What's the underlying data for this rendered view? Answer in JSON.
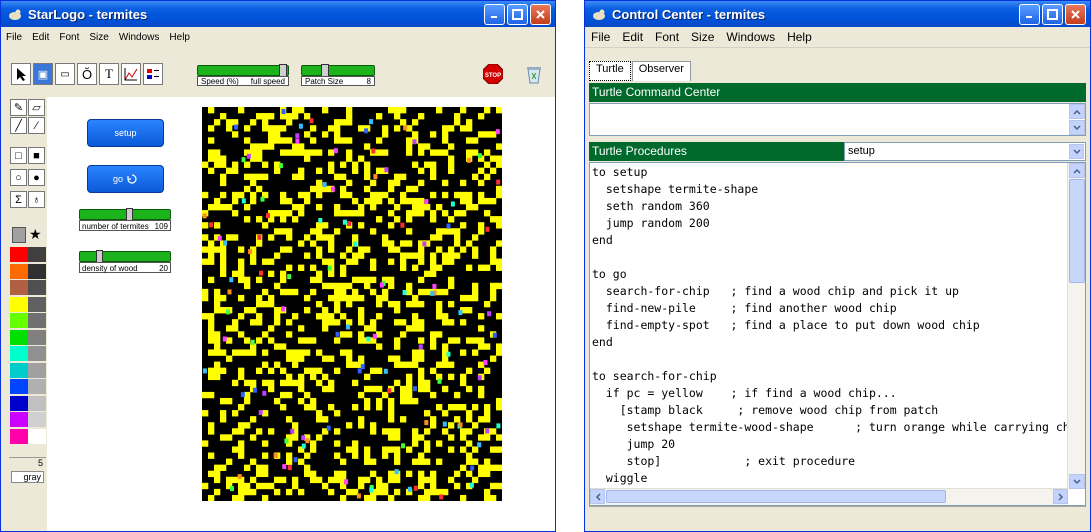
{
  "starlogo": {
    "title": "StarLogo - termites",
    "menu": [
      "File",
      "Edit",
      "Font",
      "Size",
      "Windows",
      "Help"
    ],
    "speed_slider": {
      "label": "Speed (%)",
      "value": "full speed",
      "level": 0.97
    },
    "patch_slider": {
      "label": "Patch Size",
      "value": "8",
      "level": 0.3
    },
    "stop_label": "STOP",
    "buttons": {
      "setup": "setup",
      "go": "go"
    },
    "sliders": [
      {
        "label": "number of termites",
        "value": "109",
        "level": 0.55
      },
      {
        "label": "density of wood",
        "value": "20",
        "level": 0.2
      }
    ],
    "color_readout": {
      "number": "5",
      "name": "gray"
    },
    "palette": [
      "#ff0000",
      "#404040",
      "#ff6a00",
      "#303030",
      "#b06040",
      "#505050",
      "#ffff00",
      "#606060",
      "#66ff00",
      "#707070",
      "#00e000",
      "#808080",
      "#00ffcc",
      "#909090",
      "#00cccc",
      "#a0a0a0",
      "#0044ff",
      "#b0b0b0",
      "#0000cc",
      "#c0c0c0",
      "#cc00ff",
      "#d0d0d0",
      "#ff00aa",
      "#ffffff"
    ],
    "world": {
      "grid_cols": 50,
      "grid_rows": 65,
      "background": "#000000",
      "wood_color": "#ffff00",
      "termite_count": 109,
      "wood_density": 20
    }
  },
  "control_center": {
    "title": "Control Center - termites",
    "menu": [
      "File",
      "Edit",
      "Font",
      "Size",
      "Windows",
      "Help"
    ],
    "tabs": [
      "Turtle",
      "Observer"
    ],
    "command_center_label": "Turtle Command Center",
    "procedures_label": "Turtle Procedures",
    "procedure_select": "setup",
    "code": "to setup\n  setshape termite-shape\n  seth random 360\n  jump random 200\nend\n\nto go\n  search-for-chip   ; find a wood chip and pick it up\n  find-new-pile     ; find another wood chip\n  find-empty-spot   ; find a place to put down wood chip\nend\n\nto search-for-chip\n  if pc = yellow    ; if find a wood chip...\n    [stamp black     ; remove wood chip from patch\n     setshape termite-wood-shape      ; turn orange while carrying chip\n     jump 20\n     stop]            ; exit procedure\n  wiggle\n  search-for-chip"
  },
  "colors": {
    "titlebar": "#0a5ee0",
    "green_header": "#006a2c",
    "slider_green": "#1db31d"
  }
}
